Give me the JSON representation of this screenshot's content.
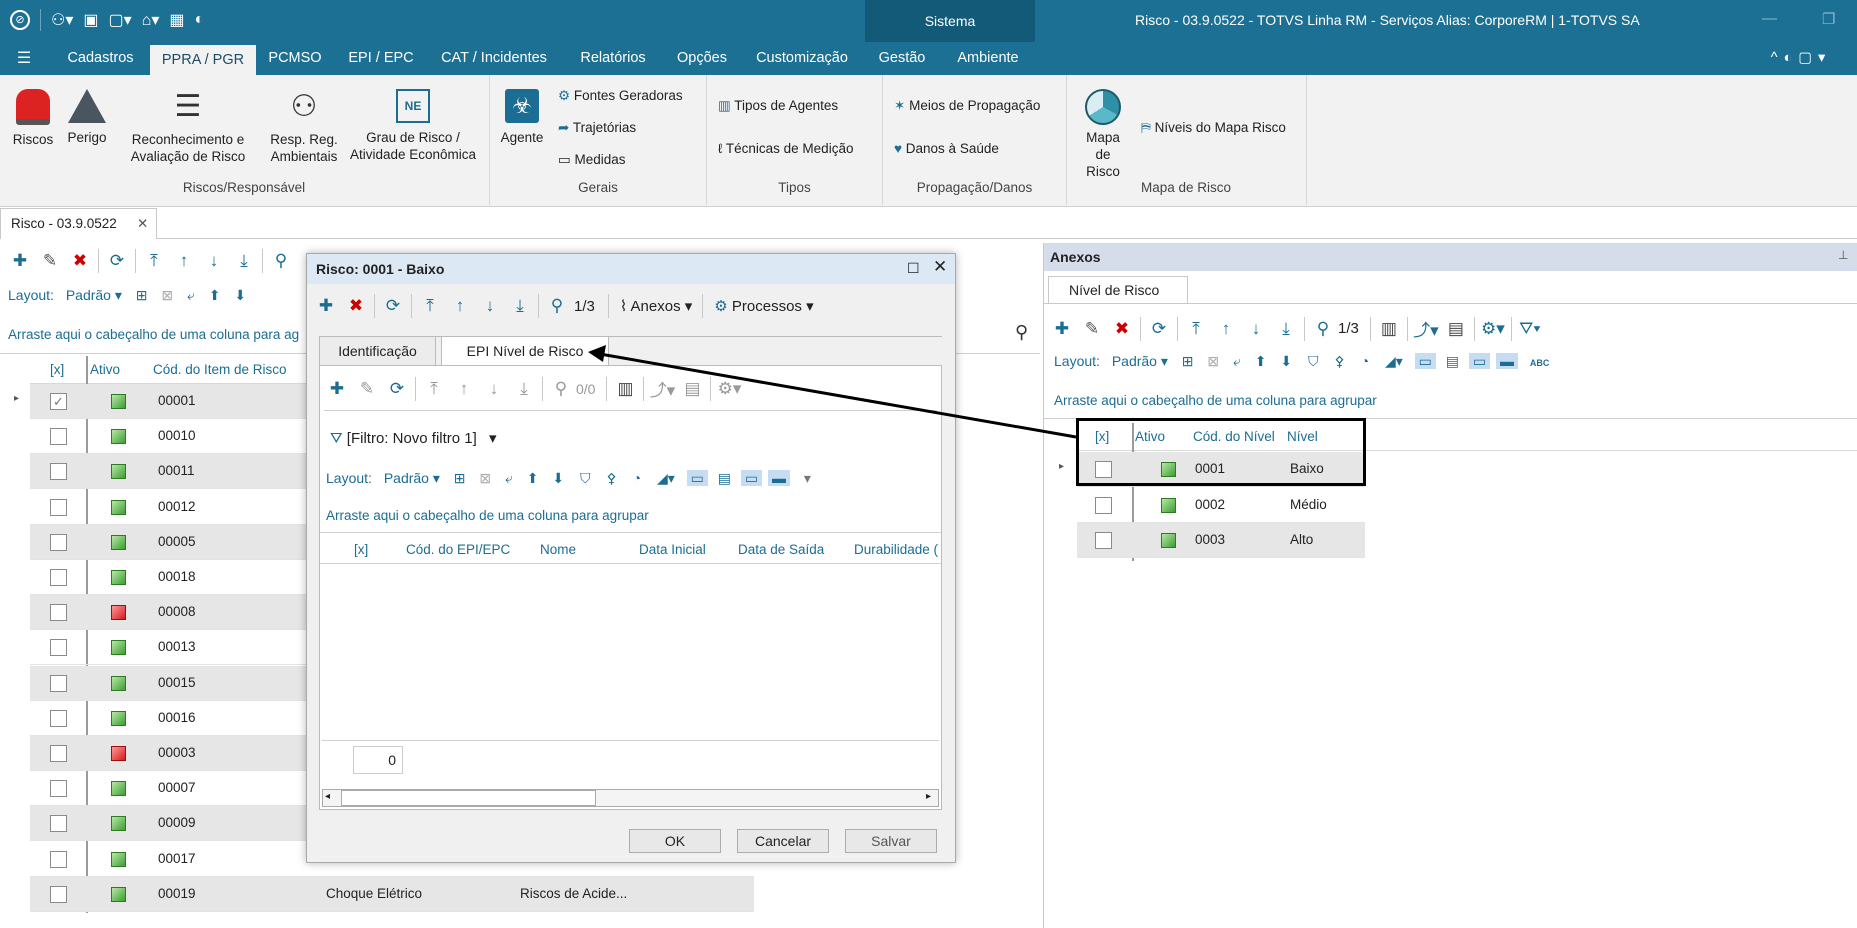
{
  "window": {
    "title": "Risco - 03.9.0522 - TOTVS Linha RM - Serviços  Alias: CorporeRM | 1-TOTVS SA",
    "system_tab": "Sistema"
  },
  "menu": [
    "Cadastros",
    "PPRA / PGR",
    "PCMSO",
    "EPI / EPC",
    "CAT / Incidentes",
    "Relatórios",
    "Opções",
    "Customização",
    "Gestão",
    "Ambiente"
  ],
  "ribbon": {
    "riscos": "Riscos",
    "perigo": "Perigo",
    "reconhecimento": "Reconhecimento e Avaliação de Risco",
    "resp": "Resp. Reg. Ambientais",
    "grau": "Grau de Risco / Atividade Econômica",
    "group1": "Riscos/Responsável",
    "agente": "Agente",
    "fontes": "Fontes Geradoras",
    "trajetorias": "Trajetórias",
    "medidas": "Medidas",
    "group2": "Gerais",
    "tipos_agentes": "Tipos de Agentes",
    "tecnicas": "Técnicas de Medição",
    "group3": "Tipos",
    "meios": "Meios de Propagação",
    "danos": "Danos à Saúde",
    "group4": "Propagação/Danos",
    "mapa": "Mapa de Risco",
    "niveis_mapa": "Níveis do Mapa Risco",
    "group5": "Mapa de Risco"
  },
  "doc_tab": "Risco - 03.9.0522",
  "main": {
    "layout_label": "Layout:",
    "layout_value": "Padrão",
    "group_hint": "Arraste aqui o cabeçalho de uma coluna para ag",
    "columns": [
      "[x]",
      "Ativo",
      "Cód. do Item de Risco"
    ],
    "rows": [
      {
        "code": "00001",
        "status": "green"
      },
      {
        "code": "00010",
        "status": "green"
      },
      {
        "code": "00011",
        "status": "green"
      },
      {
        "code": "00012",
        "status": "green"
      },
      {
        "code": "00005",
        "status": "green"
      },
      {
        "code": "00018",
        "status": "green"
      },
      {
        "code": "00008",
        "status": "red"
      },
      {
        "code": "00013",
        "status": "green"
      },
      {
        "code": "00015",
        "status": "green"
      },
      {
        "code": "00016",
        "status": "green"
      },
      {
        "code": "00003",
        "status": "red"
      },
      {
        "code": "00007",
        "status": "green"
      },
      {
        "code": "00009",
        "status": "green"
      },
      {
        "code": "00017",
        "status": "green"
      },
      {
        "code": "00019",
        "status": "green"
      }
    ],
    "last_row_name": "Choque Elétrico",
    "last_row_type": "Riscos de Acide..."
  },
  "dialog": {
    "title": "Risco: 0001 - Baixo",
    "record": "1/3",
    "anexos": "Anexos",
    "processos": "Processos",
    "tabs": [
      "Identificação",
      "EPI Nível de Risco"
    ],
    "inner_record": "0/0",
    "filter": "[Filtro: Novo filtro 1]",
    "layout_label": "Layout:",
    "layout_value": "Padrão",
    "group_hint": "Arraste aqui o cabeçalho de uma coluna para agrupar",
    "columns": [
      "[x]",
      "Cód. do EPI/EPC",
      "Nome",
      "Data Inicial",
      "Data de Saída",
      "Durabilidade ("
    ],
    "count": "0",
    "ok": "OK",
    "cancel": "Cancelar",
    "save": "Salvar"
  },
  "anexos": {
    "title": "Anexos",
    "tab": "Nível de Risco",
    "record": "1/3",
    "layout_label": "Layout:",
    "layout_value": "Padrão",
    "group_hint": "Arraste aqui o cabeçalho de uma coluna para agrupar",
    "columns": [
      "[x]",
      "Ativo",
      "Cód. do Nível",
      "Nível"
    ],
    "rows": [
      {
        "code": "0001",
        "level": "Baixo"
      },
      {
        "code": "0002",
        "level": "Médio"
      },
      {
        "code": "0003",
        "level": "Alto"
      }
    ]
  }
}
